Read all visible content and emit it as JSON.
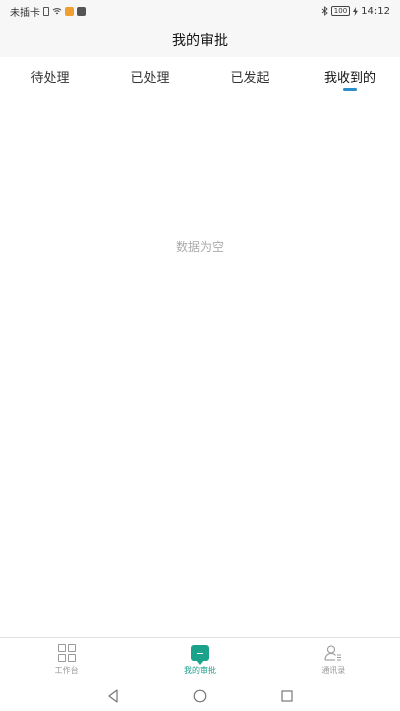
{
  "status_bar": {
    "carrier": "未插卡",
    "battery": "100",
    "time": "14:12"
  },
  "header": {
    "title": "我的审批"
  },
  "tabs": [
    {
      "label": "待处理",
      "active": false
    },
    {
      "label": "已处理",
      "active": false
    },
    {
      "label": "已发起",
      "active": false
    },
    {
      "label": "我收到的",
      "active": true
    }
  ],
  "main": {
    "empty_text": "数据为空"
  },
  "bottom_nav": {
    "items": [
      {
        "label": "工作台",
        "icon": "grid-icon",
        "active": false
      },
      {
        "label": "我的审批",
        "icon": "message-icon",
        "active": true
      },
      {
        "label": "通讯录",
        "icon": "contacts-icon",
        "active": false
      }
    ]
  },
  "colors": {
    "accent": "#2a8ec9",
    "active_nav": "#1aa28a",
    "empty_text": "#aaaaaa"
  }
}
